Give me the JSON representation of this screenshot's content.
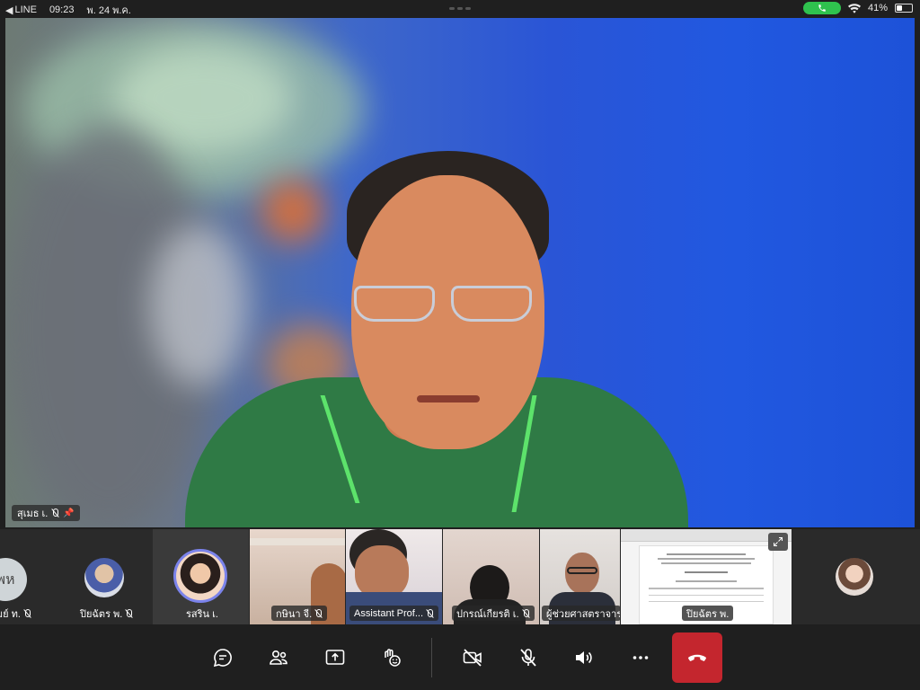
{
  "status_bar": {
    "back_app": "LINE",
    "time": "09:23",
    "date": "พ. 24 พ.ค.",
    "battery": "41%"
  },
  "main_speaker": {
    "name": "สุเมธ เ."
  },
  "participants": [
    {
      "name": "ปริมย์ ท.",
      "initials": "พห"
    },
    {
      "name": "ปิยฉัตร พ."
    },
    {
      "name": "รสริน เ."
    },
    {
      "name": "กษินา จี."
    },
    {
      "name": "Assistant Prof..."
    },
    {
      "name": "ปกรณ์เกียรติ เ."
    },
    {
      "name": "ผู้ช่วยศาสตราจาร..."
    },
    {
      "name": "ปิยฉัตร พ."
    }
  ],
  "icons": {
    "chat": "chat-icon",
    "people": "people-icon",
    "share": "share-screen-icon",
    "react": "raise-hand-icon",
    "camera": "camera-off-icon",
    "mic": "mic-off-icon",
    "speaker": "speaker-icon",
    "more": "more-icon",
    "leave": "hang-up-icon"
  },
  "colors": {
    "leave": "#c4262e",
    "call_pill": "#2fc24e",
    "collar": "#5de36b"
  }
}
